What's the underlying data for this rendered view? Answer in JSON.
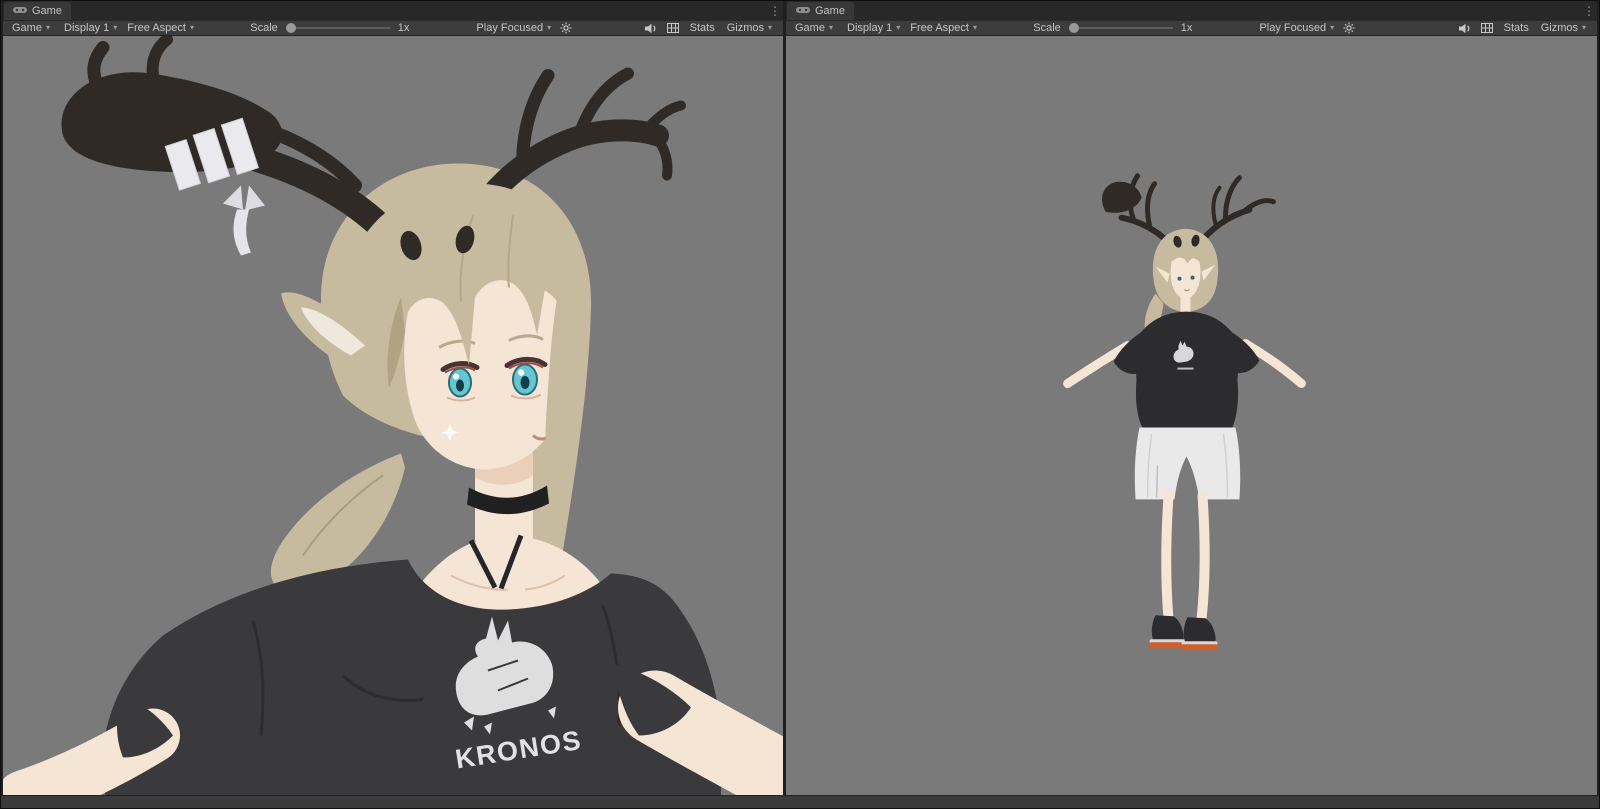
{
  "icons": {
    "menu_kebab": "⋮",
    "dropdown_arrow": "▾"
  },
  "panels": [
    {
      "tab_label": "Game",
      "toolbar": {
        "game": "Game",
        "display": "Display 1",
        "aspect": "Free Aspect",
        "scale_label": "Scale",
        "scale_value": "1x",
        "play_focused": "Play Focused",
        "stats": "Stats",
        "gizmos": "Gizmos"
      }
    },
    {
      "tab_label": "Game",
      "toolbar": {
        "game": "Game",
        "display": "Display 1",
        "aspect": "Free Aspect",
        "scale_label": "Scale",
        "scale_value": "1x",
        "play_focused": "Play Focused",
        "stats": "Stats",
        "gizmos": "Gizmos"
      }
    }
  ],
  "scene": {
    "shirt_logo_text": "KRONOS",
    "background_color": "#7a7a7a",
    "colors": {
      "hair": "#c7bb9f",
      "hair_shadow": "#b0a384",
      "antler": "#2f2a26",
      "bandage": "#e9e9ee",
      "skin": "#f5e5d4",
      "skin_shadow": "#e6c7b1",
      "eye": "#63c7d3",
      "choker": "#202022",
      "shirt": "#3a3a3d",
      "shirt_dark": "#2c2c2f",
      "logo": "#dedede",
      "shorts": "#e9e9e9",
      "shoe": "#2c2c2e",
      "shoe_sole": "#cf5f2c",
      "hair_tie": "#7ba8c4"
    }
  }
}
